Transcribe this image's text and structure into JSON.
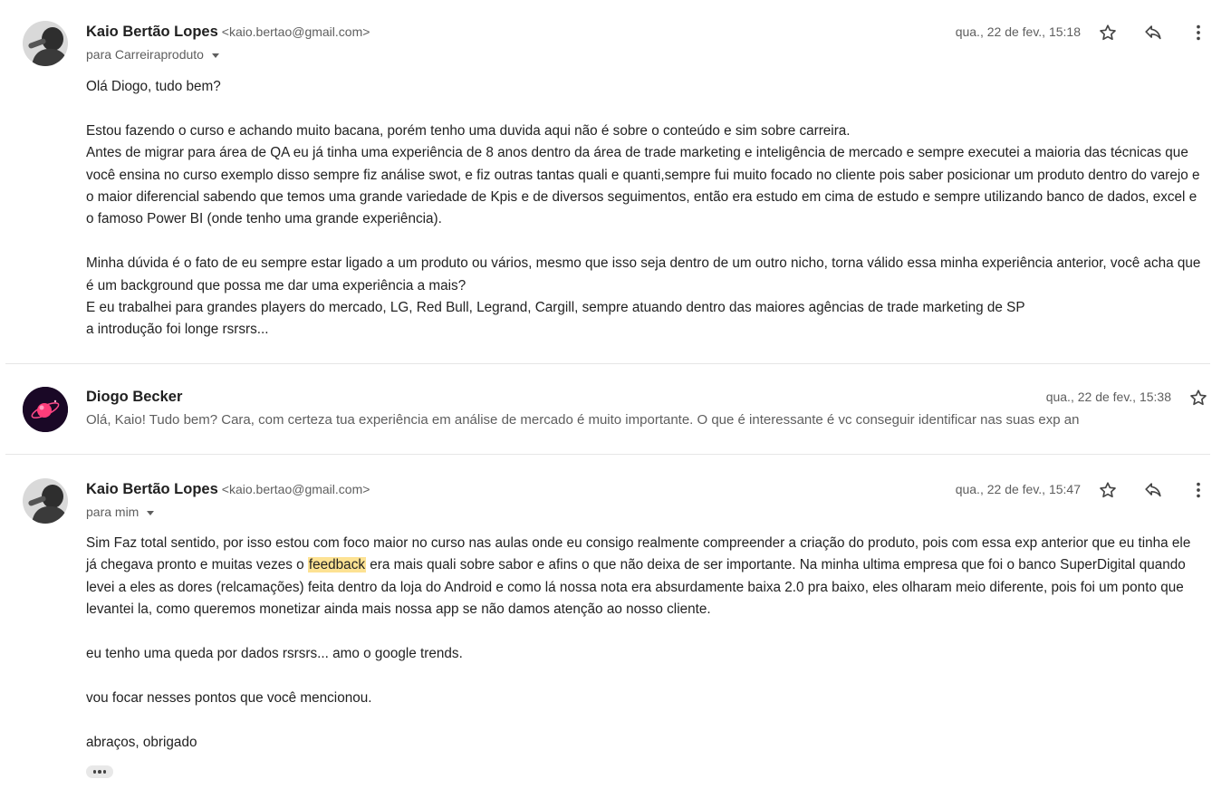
{
  "messages": [
    {
      "sender_name": "Kaio Bertão Lopes",
      "sender_email": "<kaio.bertao@gmail.com>",
      "recipient": "para Carreiraproduto",
      "date": "qua., 22 de fev., 15:18",
      "paragraphs": [
        [
          "Olá Diogo, tudo bem?"
        ],
        [
          "Estou fazendo o curso e achando muito bacana, porém tenho uma duvida aqui não é sobre o conteúdo e sim sobre carreira.",
          "Antes de migrar para área de QA eu já tinha uma experiência de 8 anos dentro da área de trade marketing e inteligência de mercado e sempre executei a maioria das técnicas que você ensina no curso exemplo disso sempre fiz análise swot, e fiz outras tantas quali e quanti,sempre fui muito focado no cliente pois saber posicionar um produto dentro do varejo e o maior diferencial sabendo que temos uma grande variedade de Kpis e de diversos seguimentos, então era estudo em cima de estudo e sempre utilizando banco de dados, excel e o famoso Power BI (onde tenho uma grande experiência)."
        ],
        [
          "Minha dúvida é o fato de eu sempre estar ligado a um produto ou vários, mesmo que isso seja dentro de um outro nicho, torna válido essa minha experiência anterior, você acha que é um background que possa me dar uma experiência a mais?",
          "E eu trabalhei para grandes players do mercado, LG, Red Bull, Legrand, Cargill, sempre atuando dentro das maiores agências de trade marketing de SP",
          "a introdução foi longe rsrsrs..."
        ]
      ]
    },
    {
      "sender_name": "Diogo Becker",
      "date": "qua., 22 de fev., 15:38",
      "snippet": "Olá, Kaio! Tudo bem? Cara, com certeza tua experiência em análise de mercado é muito importante. O que é interessante é vc conseguir identificar nas suas exp an"
    },
    {
      "sender_name": "Kaio Bertão Lopes",
      "sender_email": "<kaio.bertao@gmail.com>",
      "recipient": "para mim",
      "date": "qua., 22 de fev., 15:47",
      "para1_before": "Sim Faz total sentido, por isso estou com foco maior no curso nas aulas onde eu consigo realmente compreender a criação do produto, pois com essa exp anterior que eu tinha ele já chegava pronto e muitas vezes o ",
      "para1_highlight": "feedback",
      "para1_after": " era mais quali sobre sabor e afins o que não deixa de ser importante. Na minha ultima empresa que foi o banco SuperDigital quando levei a eles as dores (relcamações) feita dentro da loja do Android e como lá nossa nota era absurdamente baixa 2.0 pra baixo, eles olharam meio diferente, pois foi um ponto que levantei la, como queremos monetizar ainda mais nossa app se não damos atenção ao nosso cliente.",
      "para2": "eu tenho uma queda por dados rsrsrs... amo o google trends.",
      "para3": "vou focar nesses pontos que você mencionou.",
      "para4": "abraços, obrigado"
    }
  ],
  "icons": {
    "star": "star-icon",
    "reply": "reply-icon",
    "more": "more-vert-icon",
    "expand": "show-trimmed-content-icon"
  },
  "colors": {
    "highlight": "#fde293",
    "text": "#222222",
    "muted": "#5e5e5e"
  }
}
